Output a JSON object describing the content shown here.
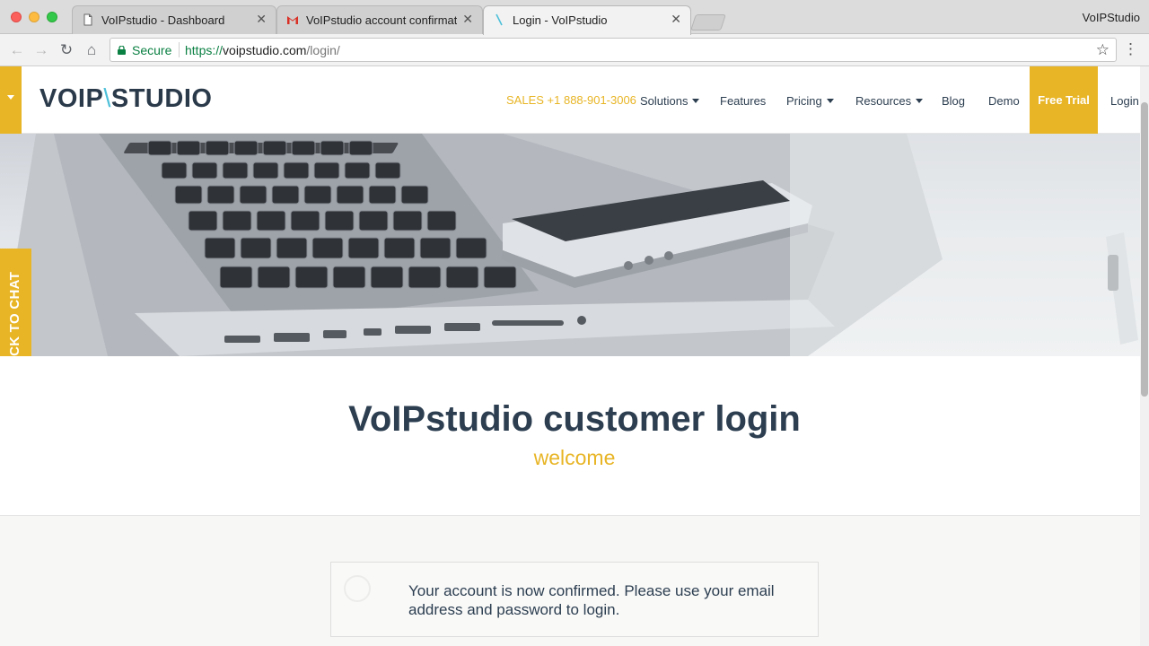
{
  "browser": {
    "tabs": [
      {
        "title": "VoIPstudio - Dashboard",
        "icon": "page-icon"
      },
      {
        "title": "VoIPstudio account confirmatio",
        "icon": "gmail-icon"
      },
      {
        "title": "Login - VoIPstudio",
        "icon": "voipstudio-favicon"
      }
    ],
    "profile_name": "VoIPStudio",
    "secure_label": "Secure",
    "url_scheme": "https://",
    "url_host": "voipstudio.com",
    "url_path": "/login/"
  },
  "header": {
    "logo_left": "VOIP",
    "logo_slash": "\\",
    "logo_right": "STUDIO",
    "sales": "SALES +1 888-901-3006",
    "nav": [
      "Solutions",
      "Features",
      "Pricing",
      "Resources",
      "Blog",
      "Demo"
    ],
    "free_trial": "Free Trial",
    "login": "Login"
  },
  "chat": {
    "label": "CLICK TO CHAT"
  },
  "main": {
    "title": "VoIPstudio customer login",
    "subtitle": "welcome",
    "alert": "Your account is now confirmed. Please use your email address and password to login."
  },
  "colors": {
    "accent": "#e8b526",
    "text": "#2c3e50",
    "secure_green": "#0b8043"
  }
}
